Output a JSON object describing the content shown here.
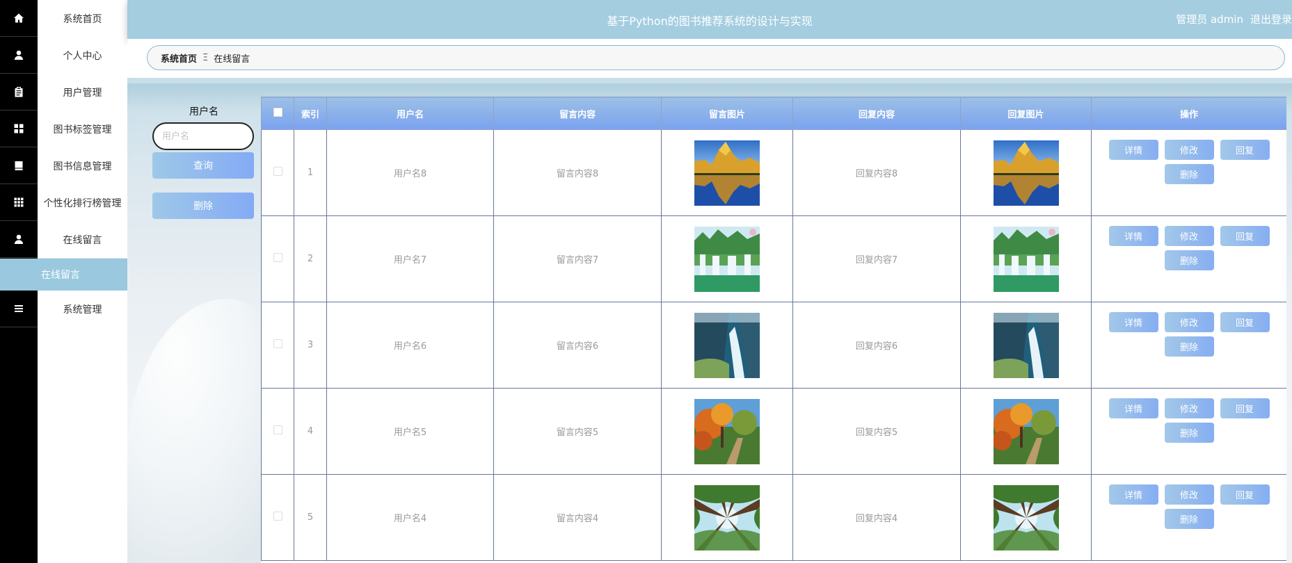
{
  "app": {
    "title": "基于Python的图书推荐系统的设计与实现",
    "user_label": "管理员 admin",
    "logout_label": "退出登录"
  },
  "sidebar": {
    "items": [
      {
        "label": "系统首页",
        "icon": "home-icon"
      },
      {
        "label": "个人中心",
        "icon": "person-icon"
      },
      {
        "label": "用户管理",
        "icon": "clipboard-icon"
      },
      {
        "label": "图书标签管理",
        "icon": "grid-icon"
      },
      {
        "label": "图书信息管理",
        "icon": "book-icon"
      },
      {
        "label": "个性化排行榜管理",
        "icon": "apps-icon"
      },
      {
        "label": "在线留言",
        "icon": "person-icon"
      },
      {
        "label": "系统管理",
        "icon": "list-icon"
      }
    ],
    "active_sub": "在线留言"
  },
  "breadcrumb": {
    "home": "系统首页",
    "separator": "Ξ",
    "current": "在线留言"
  },
  "search": {
    "label": "用户名",
    "placeholder": "用户名",
    "value": "",
    "query_button": "查询",
    "delete_button": "删除"
  },
  "table": {
    "columns": [
      "索引",
      "用户名",
      "留言内容",
      "留言图片",
      "回复内容",
      "回复图片",
      "操作"
    ],
    "rows": [
      {
        "index": "1",
        "username": "用户名8",
        "content": "留言内容8",
        "image": "mountain-lake",
        "reply": "回复内容8",
        "reply_image": "mountain-lake"
      },
      {
        "index": "2",
        "username": "用户名7",
        "content": "留言内容7",
        "image": "waterfalls",
        "reply": "回复内容7",
        "reply_image": "waterfalls"
      },
      {
        "index": "3",
        "username": "用户名6",
        "content": "留言内容6",
        "image": "cliff-waterfall",
        "reply": "回复内容6",
        "reply_image": "cliff-waterfall"
      },
      {
        "index": "4",
        "username": "用户名5",
        "content": "留言内容5",
        "image": "autumn-trees",
        "reply": "回复内容5",
        "reply_image": "autumn-trees"
      },
      {
        "index": "5",
        "username": "用户名4",
        "content": "留言内容4",
        "image": "forest-canopy",
        "reply": "回复内容4",
        "reply_image": "forest-canopy"
      }
    ],
    "row_actions": {
      "detail": "详情",
      "edit": "修改",
      "reply": "回复",
      "delete": "删除"
    }
  },
  "colors": {
    "header": "#a4cde0",
    "active_menu": "#9ac8df",
    "table_header_top": "#9cc0e6",
    "table_header_bottom": "#7aa2ef",
    "button": "#86aef2"
  }
}
